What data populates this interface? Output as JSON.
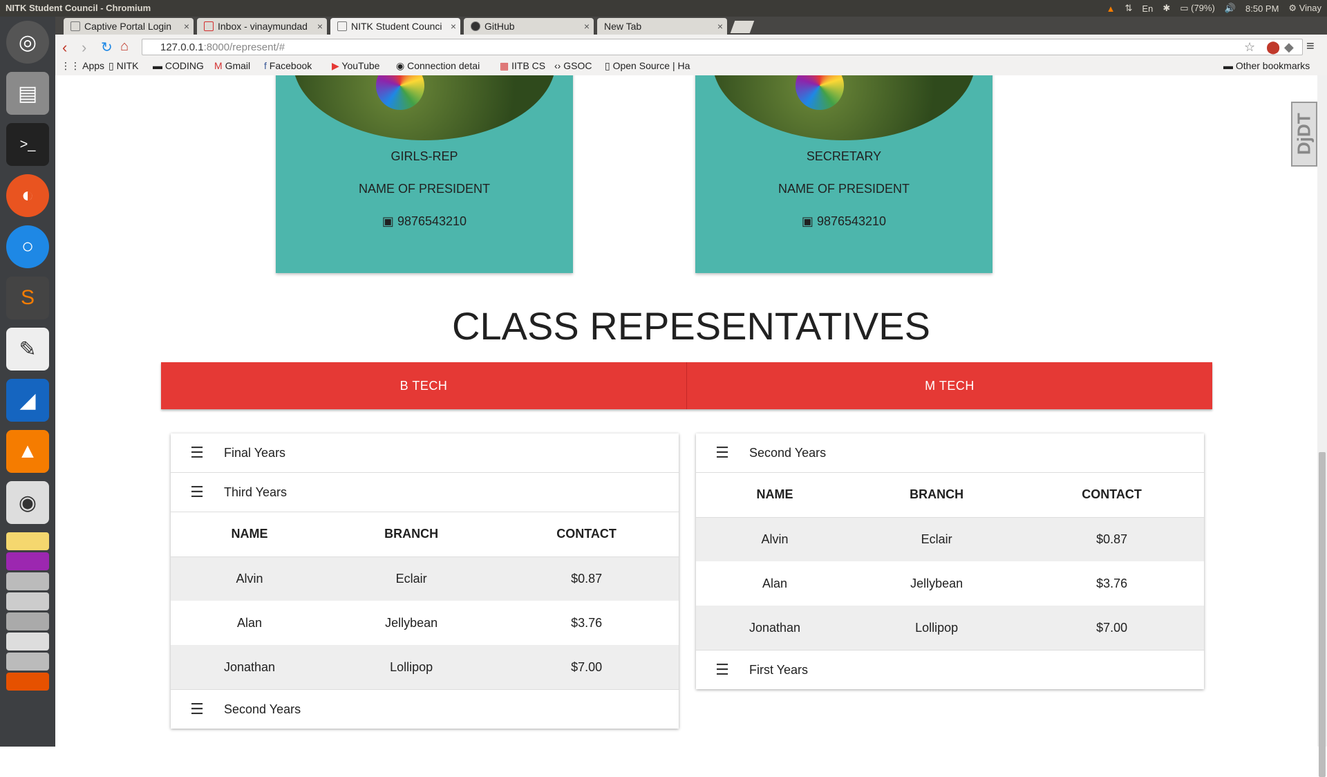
{
  "system": {
    "window_title": "NITK Student Council - Chromium",
    "battery": "(79%)",
    "time": "8:50 PM",
    "user": "Vinay",
    "keyboard": "En",
    "profile_badge": "VINAY"
  },
  "browser": {
    "tabs": [
      {
        "label": "Captive Portal Login"
      },
      {
        "label": "Inbox - vinaymundad"
      },
      {
        "label": "NITK Student Counci"
      },
      {
        "label": "GitHub"
      },
      {
        "label": "New Tab"
      }
    ],
    "url_host": "127.0.0.1",
    "url_rest": ":8000/represent/#",
    "bookmarks": [
      "Apps",
      "NITK",
      "CODING",
      "Gmail",
      "Facebook",
      "YouTube",
      "Connection detai",
      "IITB CS",
      "GSOC",
      "Open Source | Ha"
    ],
    "other_bookmarks": "Other bookmarks"
  },
  "page": {
    "reps": [
      {
        "role": "GIRLS-REP",
        "name": "NAME OF PRESIDENT",
        "phone": "9876543210"
      },
      {
        "role": "SECRETARY",
        "name": "NAME OF PRESIDENT",
        "phone": "9876543210"
      }
    ],
    "section_title": "CLASS REPESENTATIVES",
    "course_tabs": [
      "B TECH",
      "M TECH"
    ],
    "columns": [
      "NAME",
      "BRANCH",
      "CONTACT"
    ],
    "btech": {
      "groups": [
        "Final Years",
        "Third Years",
        "Second Years"
      ],
      "rows": [
        [
          "Alvin",
          "Eclair",
          "$0.87"
        ],
        [
          "Alan",
          "Jellybean",
          "$3.76"
        ],
        [
          "Jonathan",
          "Lollipop",
          "$7.00"
        ]
      ]
    },
    "mtech": {
      "groups": [
        "Second Years",
        "First Years"
      ],
      "rows": [
        [
          "Alvin",
          "Eclair",
          "$0.87"
        ],
        [
          "Alan",
          "Jellybean",
          "$3.76"
        ],
        [
          "Jonathan",
          "Lollipop",
          "$7.00"
        ]
      ]
    },
    "ddt_label": "DjDT",
    "colors": {
      "teal": "#4db6ac",
      "red": "#e53935"
    }
  }
}
